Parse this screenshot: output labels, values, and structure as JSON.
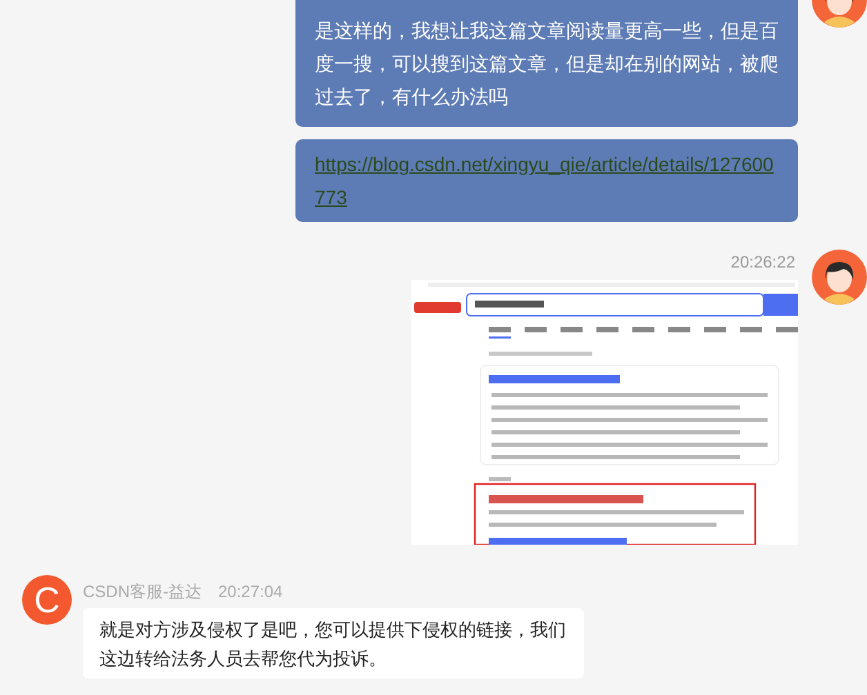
{
  "outgoing": [
    {
      "items": [
        {
          "kind": "text",
          "text": "是这样的，我想让我这篇文章阅读量更高一些，但是百度一搜，可以搜到这篇文章，但是却在别的网站，被爬过去了，有什么办法吗"
        },
        {
          "kind": "link",
          "text": "https://blog.csdn.net/xingyu_qie/article/details/127600773"
        }
      ]
    },
    {
      "items": [
        {
          "kind": "time",
          "time": "20:26:22"
        },
        {
          "kind": "image"
        }
      ]
    }
  ],
  "incoming": [
    {
      "kind": "text",
      "avatar_letter": "C",
      "sender": "CSDN客服-益达",
      "time": "20:27:04",
      "text": "就是对方涉及侵权了是吧，您可以提供下侵权的链接，我们这边转给法务人员去帮您代为投诉。"
    }
  ]
}
